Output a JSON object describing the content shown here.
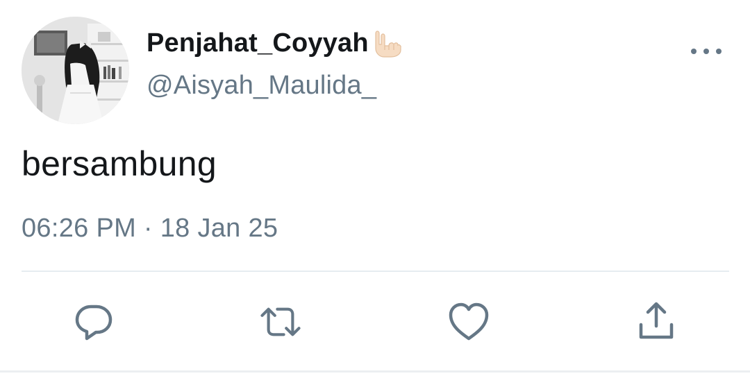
{
  "tweet": {
    "display_name": "Penjahat_Coyyah",
    "display_name_emoji": "🤟🏻",
    "handle": "@Aisyah_Maulida_",
    "text": "bersambung",
    "timestamp": "06:26 PM · 18 Jan 25"
  },
  "icons": {
    "avatar": "profile-photo",
    "more": "more-horizontal-icon",
    "reply": "reply-icon",
    "retweet": "retweet-icon",
    "like": "heart-icon",
    "share": "share-icon"
  },
  "colors": {
    "text_primary": "#14171a",
    "text_secondary": "#657786",
    "divider": "#e6ecf0"
  }
}
